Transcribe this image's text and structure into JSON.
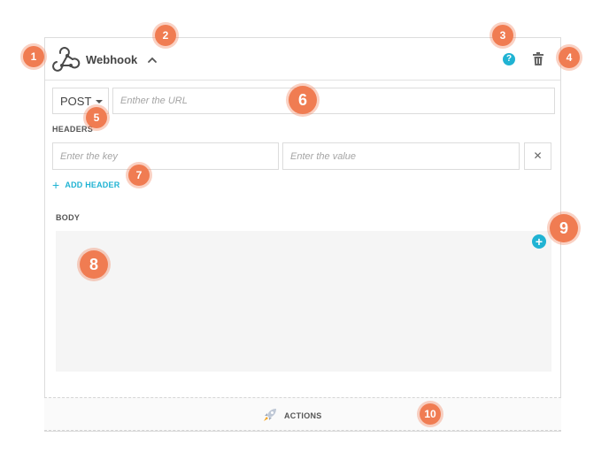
{
  "header": {
    "title": "Webhook",
    "help_icon": "?"
  },
  "request": {
    "method": "POST",
    "url_placeholder": "Enther the URL"
  },
  "headers": {
    "label": "HEADERS",
    "key_placeholder": "Enter the key",
    "value_placeholder": "Enter the value",
    "remove_glyph": "✕",
    "add_label": "ADD HEADER",
    "add_glyph": "+"
  },
  "body": {
    "label": "BODY",
    "add_glyph": "+"
  },
  "actions": {
    "label": "ACTIONS"
  },
  "callouts": [
    "1",
    "2",
    "3",
    "4",
    "5",
    "6",
    "7",
    "8",
    "9",
    "10"
  ],
  "colors": {
    "accent": "#20b3d3",
    "callout": "#f07c52",
    "border": "#dcdcdc",
    "editor_bg": "#f5f5f5"
  },
  "icons": [
    "webhook-icon",
    "chevron-up-icon",
    "help-icon",
    "trash-icon",
    "caret-down-icon",
    "close-icon",
    "plus-icon",
    "rocket-icon"
  ]
}
